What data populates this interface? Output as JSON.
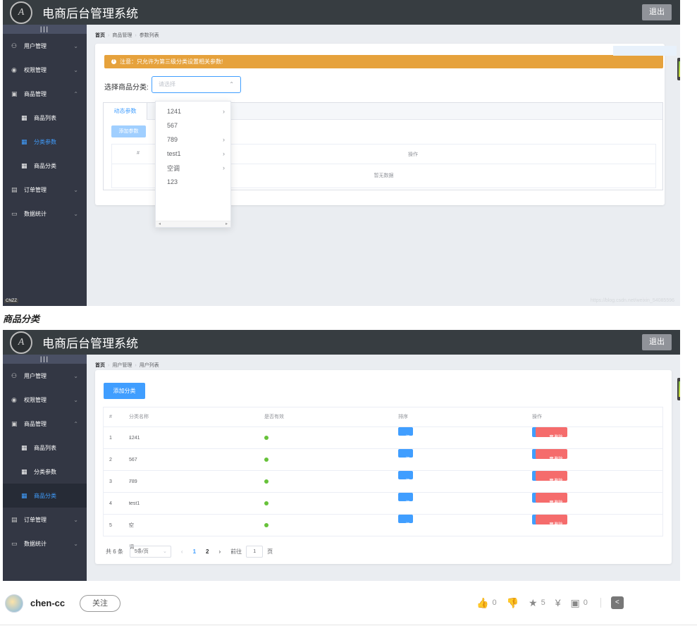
{
  "app": {
    "title": "电商后台管理系统",
    "logo_letter": "A",
    "logout": "退出"
  },
  "sidebar": {
    "toggle": "|||",
    "items": [
      {
        "label": "用户管理",
        "icon": "user-icon",
        "glyph": "⚇"
      },
      {
        "label": "权限管理",
        "icon": "lock-icon",
        "glyph": "◉"
      },
      {
        "label": "商品管理",
        "icon": "goods-icon",
        "glyph": "▣"
      },
      {
        "label": "商品列表",
        "icon": "grid-icon",
        "glyph": "▦"
      },
      {
        "label": "分类参数",
        "icon": "grid-icon",
        "glyph": "▦"
      },
      {
        "label": "商品分类",
        "icon": "grid-icon",
        "glyph": "▦"
      },
      {
        "label": "订单管理",
        "icon": "order-icon",
        "glyph": "▤"
      },
      {
        "label": "数据统计",
        "icon": "chart-icon",
        "glyph": "▭"
      }
    ],
    "footer": "CNZZ"
  },
  "shot1": {
    "breadcrumb": [
      "首页",
      "商品管理",
      "参数列表"
    ],
    "alert": "注意：只允许为第三级分类设置相关参数!",
    "select_label": "选择商品分类:",
    "select_placeholder": "请选择",
    "tab_active": "动态参数",
    "add_param": "添加参数",
    "table_cols": [
      "#",
      "操作"
    ],
    "empty": "暂无数据",
    "dropdown": [
      {
        "label": "1241",
        "has_children": true
      },
      {
        "label": "567",
        "has_children": false
      },
      {
        "label": "789",
        "has_children": true
      },
      {
        "label": "test1",
        "has_children": true
      },
      {
        "label": "空调",
        "has_children": true
      },
      {
        "label": "123",
        "has_children": false
      }
    ],
    "watermark": "https://blog.csdn.net/weixin_54085596"
  },
  "caption": "商品分类",
  "shot2": {
    "breadcrumb": [
      "首页",
      "用户管理",
      "用户列表"
    ],
    "add_category": "添加分类",
    "columns": [
      "#",
      "分类名称",
      "是否有效",
      "排序",
      "操作"
    ],
    "rows": [
      {
        "idx": "1",
        "name": "1241",
        "expandable": true
      },
      {
        "idx": "2",
        "name": "567",
        "expandable": false
      },
      {
        "idx": "3",
        "name": "789",
        "expandable": true
      },
      {
        "idx": "4",
        "name": "test1",
        "expandable": true
      },
      {
        "idx": "5",
        "name": "空调",
        "expandable": true
      }
    ],
    "level_badge": "一级",
    "edit": "编辑",
    "delete": "删除",
    "pager": {
      "total": "共 6 条",
      "page_size": "5条/页",
      "pages": [
        "1",
        "2"
      ],
      "goto_prefix": "前往",
      "goto_value": "1",
      "goto_suffix": "页"
    }
  },
  "author": {
    "name": "chen-cc",
    "follow": "关注",
    "likes": "0",
    "stars": "5",
    "comments": "0"
  },
  "colors": {
    "header": "#373d41",
    "sidebar": "#333744",
    "primary": "#409eff",
    "warning": "#e6a23c",
    "danger": "#f56c6c",
    "success": "#67c23a"
  }
}
